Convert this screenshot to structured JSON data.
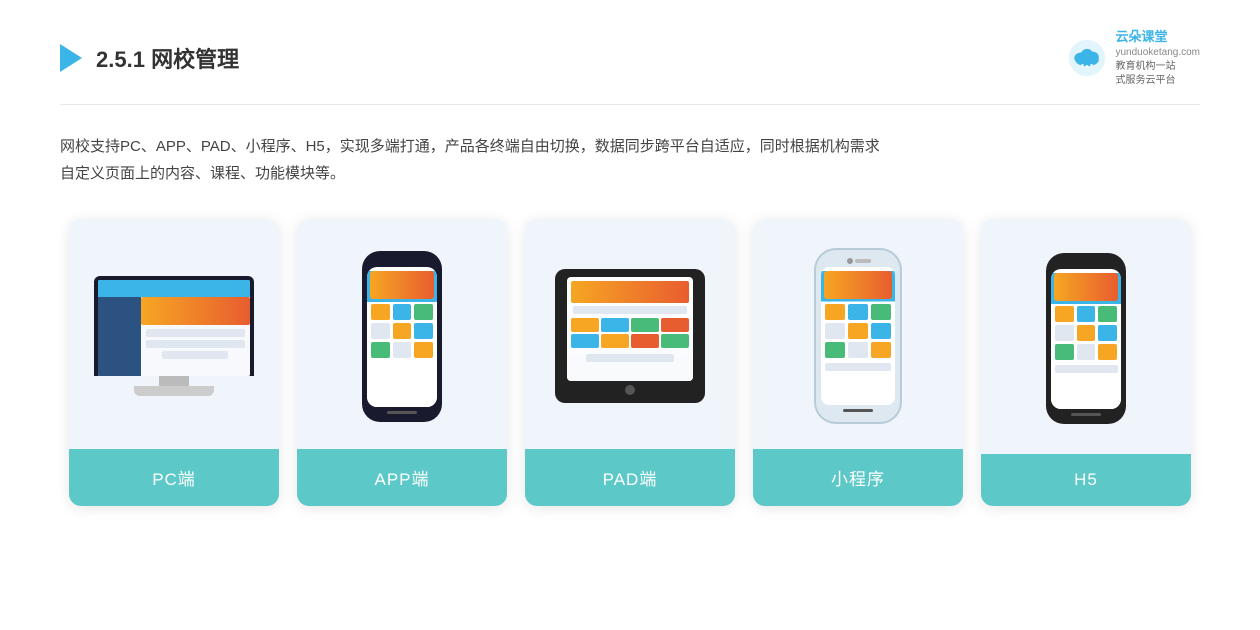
{
  "header": {
    "section_number": "2.5.1",
    "title_plain": "网校管理",
    "brand_name": "云朵课堂",
    "brand_url": "yunduoketang.com",
    "brand_tagline1": "教育机构一站",
    "brand_tagline2": "式服务云平台"
  },
  "description": {
    "text": "网校支持PC、APP、PAD、小程序、H5，实现多端打通，产品各终端自由切换，数据同步跨平台自适应，同时根据机构需求自定义页面上的内容、课程、功能模块等。"
  },
  "cards": [
    {
      "id": "pc",
      "label": "PC端",
      "type": "pc"
    },
    {
      "id": "app",
      "label": "APP端",
      "type": "phone"
    },
    {
      "id": "pad",
      "label": "PAD端",
      "type": "pad"
    },
    {
      "id": "miniprogram",
      "label": "小程序",
      "type": "miniphone"
    },
    {
      "id": "h5",
      "label": "H5",
      "type": "phone2"
    }
  ]
}
